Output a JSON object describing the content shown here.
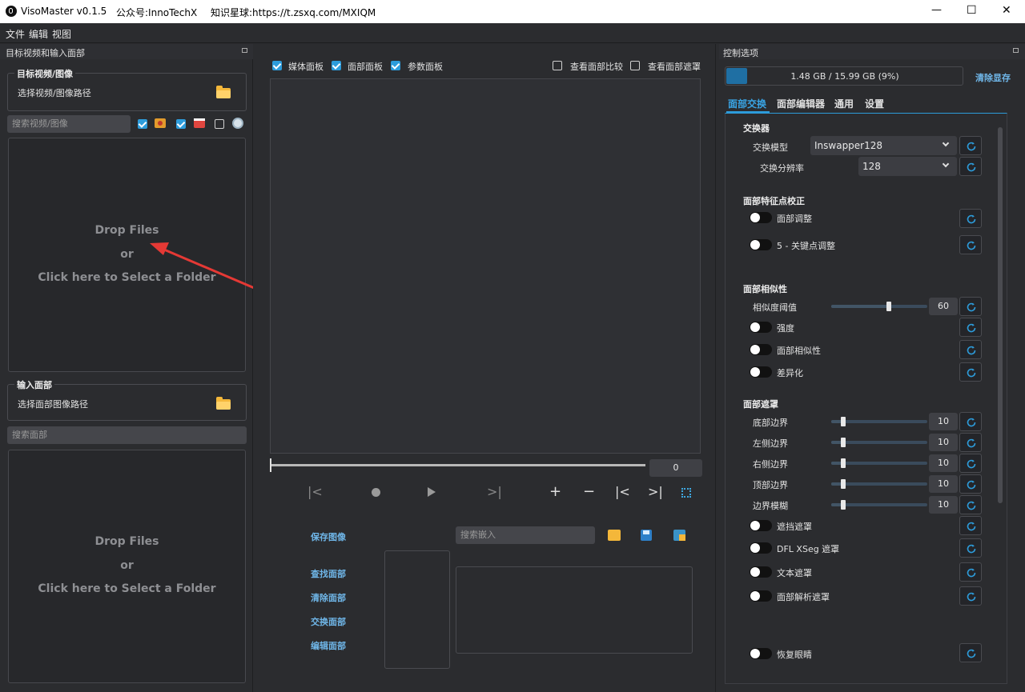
{
  "titlebar": {
    "app_title": "VisoMaster v0.1.5",
    "account": "公众号:InnoTechX",
    "link": "知识星球:https://t.zsxq.com/MXIQM",
    "minimize": "—",
    "maximize": "☐",
    "close": "✕"
  },
  "menu": [
    "文件",
    "编辑",
    "视图"
  ],
  "left_panel": {
    "title": "目标视频和输入面部",
    "target_group": {
      "title": "目标视频/图像",
      "path_label": "选择视频/图像路径"
    },
    "search_video_placeholder": "搜索视频/图像",
    "filters": {
      "video": true,
      "image": true,
      "webcam": false
    },
    "drop": {
      "line1": "Drop Files",
      "line2": "or",
      "line3": "Click here to Select a Folder"
    },
    "input_group": {
      "title": "输入面部",
      "path_label": "选择面部图像路径"
    },
    "search_face_placeholder": "搜索面部"
  },
  "center": {
    "checks": [
      {
        "label": "媒体面板",
        "checked": true
      },
      {
        "label": "面部面板",
        "checked": true
      },
      {
        "label": "参数面板",
        "checked": true
      }
    ],
    "right_checks": [
      {
        "label": "查看面部比较",
        "checked": false
      },
      {
        "label": "查看面部遮罩",
        "checked": false
      }
    ],
    "frame_value": "0",
    "actions": {
      "save": "保存图像",
      "find": "查找面部",
      "clear": "清除面部",
      "swap": "交换面部",
      "edit": "编辑面部"
    },
    "search_embed_placeholder": "搜索嵌入"
  },
  "right_panel": {
    "title": "控制选项",
    "memory": {
      "text": "1.48 GB / 15.99 GB (9%)",
      "percent": 9
    },
    "clear_vram": "清除显存",
    "tabs": [
      "面部交换",
      "面部编辑器",
      "通用",
      "设置"
    ],
    "active_tab": 0,
    "swapper": {
      "section": "交换器",
      "model_label": "交换模型",
      "model_value": "Inswapper128",
      "resolution_label": "交换分辨率",
      "resolution_value": "128"
    },
    "landmark": {
      "section": "面部特征点校正",
      "toggles": [
        "面部调整",
        "5 - 关键点调整"
      ]
    },
    "similarity": {
      "section": "面部相似性",
      "threshold_label": "相似度阈值",
      "threshold_value": "60",
      "threshold_fraction": 0.6,
      "toggles": [
        "强度",
        "面部相似性",
        "差异化"
      ]
    },
    "mask": {
      "section": "面部遮罩",
      "sliders": [
        {
          "label": "底部边界",
          "value": "10"
        },
        {
          "label": "左侧边界",
          "value": "10"
        },
        {
          "label": "右侧边界",
          "value": "10"
        },
        {
          "label": "顶部边界",
          "value": "10"
        },
        {
          "label": "边界模糊",
          "value": "10"
        }
      ],
      "toggles": [
        "遮挡遮罩",
        "DFL XSeg 遮罩",
        "文本遮罩",
        "面部解析遮罩"
      ]
    },
    "restore": {
      "toggles": [
        "恢复眼睛"
      ]
    }
  },
  "colors": {
    "accent": "#2d9cdb",
    "link": "#6fb6e8",
    "bg": "#2b2c2f",
    "memory_fill": "#1f6fa3"
  }
}
